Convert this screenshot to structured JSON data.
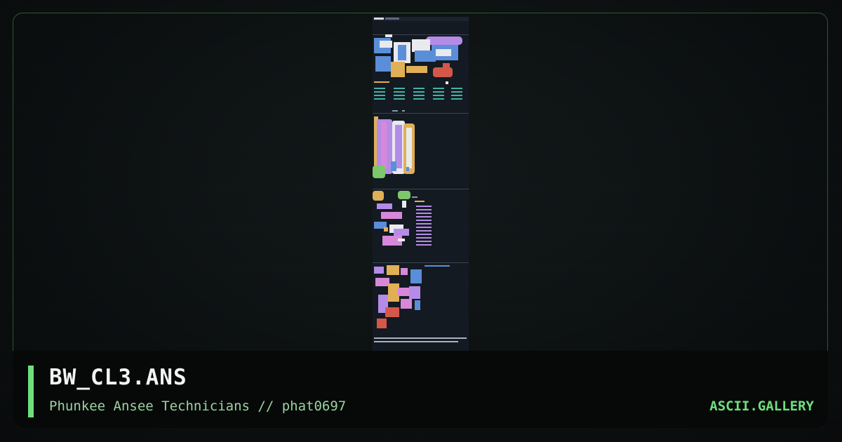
{
  "artwork": {
    "filename": "BW_CL3.ANS",
    "credits": "Phunkee Ansee Technicians // phat0697"
  },
  "site": {
    "brand": "ASCII.GALLERY"
  },
  "colors": {
    "accent": "#6ee07a",
    "frame_border": "#2b5a2f",
    "background": "#0b0f10",
    "art_background": "#141a22"
  }
}
